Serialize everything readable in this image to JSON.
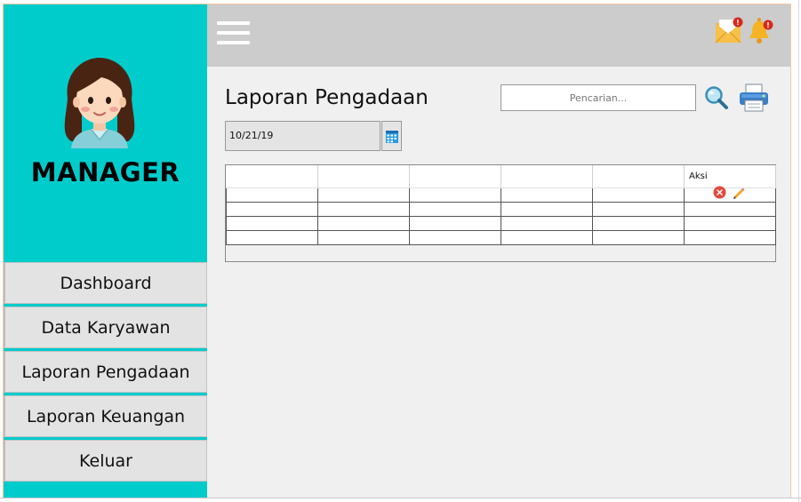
{
  "sidebar": {
    "role": "MANAGER",
    "menu": [
      {
        "label": "Dashboard"
      },
      {
        "label": "Data Karyawan"
      },
      {
        "label": "Laporan Pengadaan"
      },
      {
        "label": "Laporan Keuangan"
      },
      {
        "label": "Keluar"
      }
    ]
  },
  "topbar": {
    "menu_icon": "hamburger-icon",
    "mail_icon": "mail-icon",
    "mail_badge": "!",
    "bell_icon": "bell-icon",
    "bell_badge": "!"
  },
  "main": {
    "title": "Laporan Pengadaan",
    "search_placeholder": "Pencarian...",
    "date": "10/21/19",
    "table": {
      "headers": [
        "",
        "",
        "",
        "",
        "",
        "Aksi"
      ],
      "rows": 4
    }
  },
  "colors": {
    "sidebar_bg": "#00cccc",
    "topbar_bg": "#cccccc",
    "content_bg": "#f0f0f0",
    "menu_bg": "#e3e3e3",
    "delete_red": "#e04b3c",
    "edit_orange": "#f5a623"
  }
}
